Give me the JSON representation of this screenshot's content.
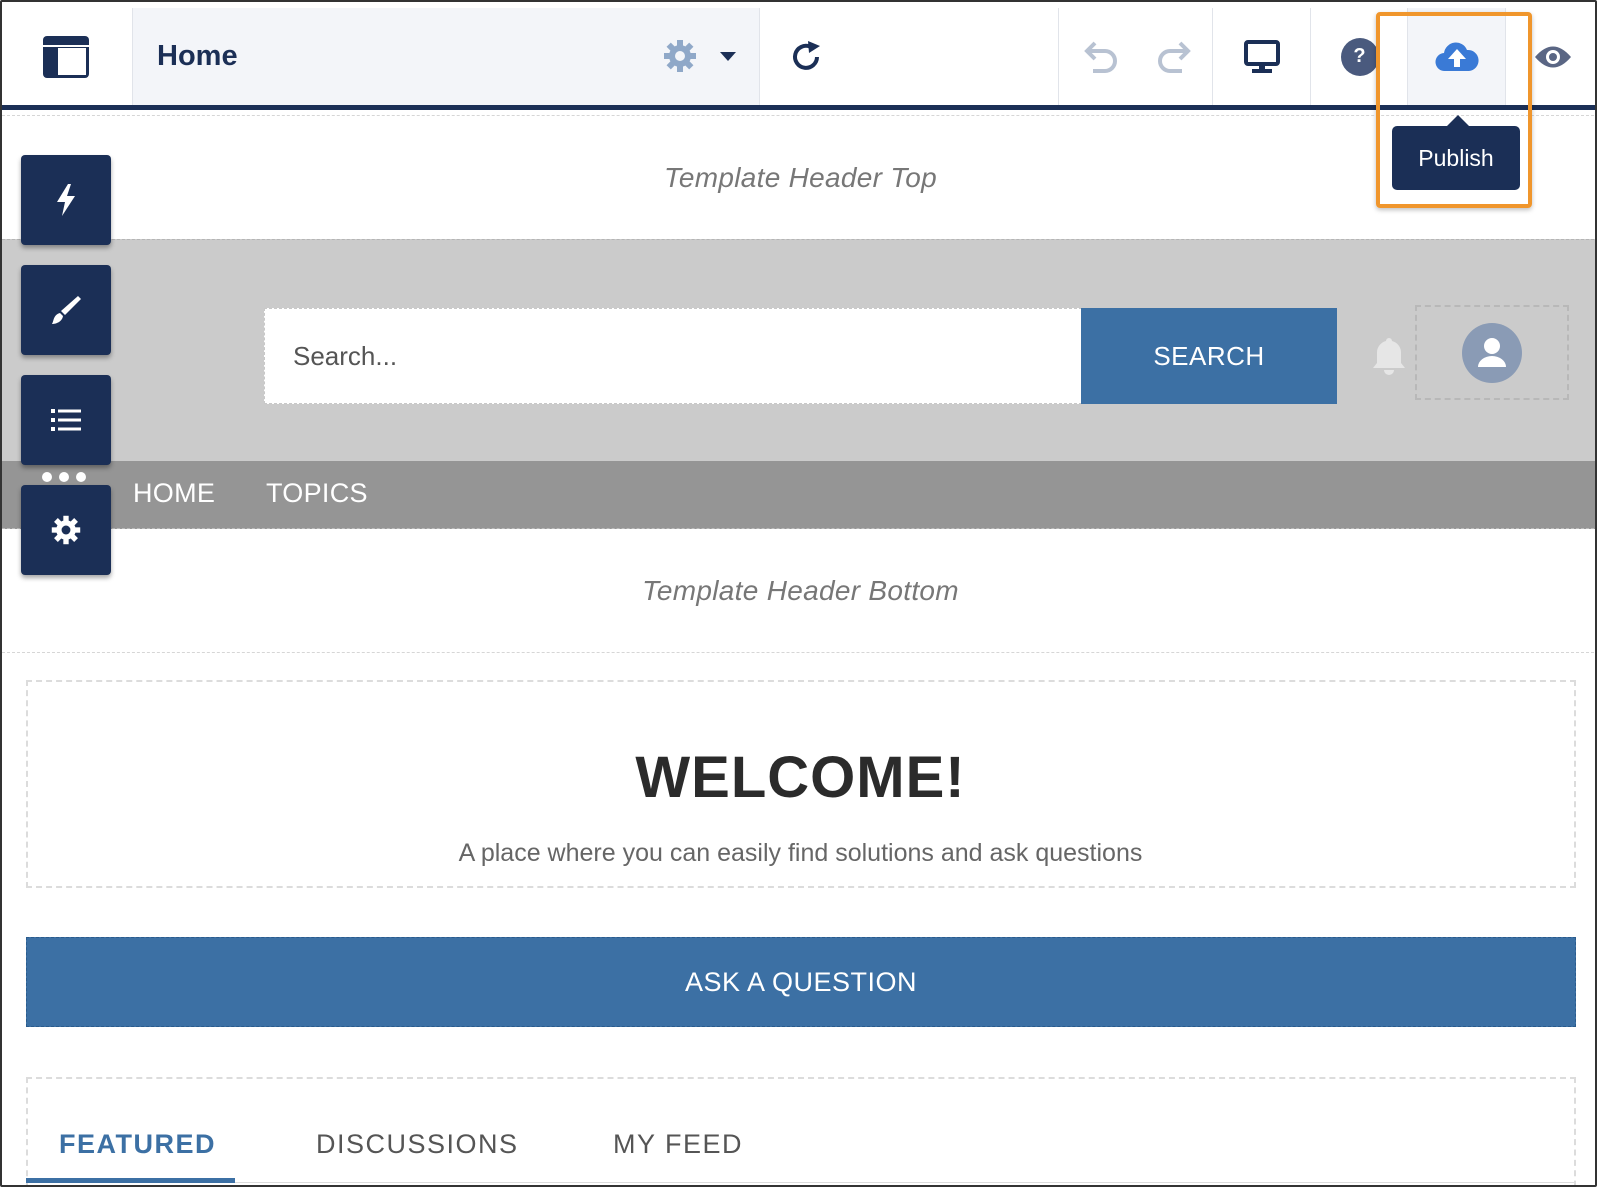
{
  "toolbar": {
    "page_title": "Home",
    "publish_tooltip": "Publish"
  },
  "icons": {
    "layout": "layout-icon",
    "page_settings": "gear-icon",
    "page_menu": "chevron-down-icon",
    "refresh": "refresh-icon",
    "undo": "undo-icon",
    "redo": "redo-icon",
    "device": "desktop-icon",
    "help": "help-icon",
    "publish": "cloud-upload-icon",
    "preview": "eye-icon",
    "components": "lightning-icon",
    "theme": "brush-icon",
    "page_structure": "list-icon",
    "settings": "gear-icon",
    "notifications": "bell-icon",
    "user": "user-avatar-icon"
  },
  "canvas": {
    "header_top_label": "Template Header Top",
    "header_bottom_label": "Template Header Bottom",
    "search": {
      "placeholder": "Search...",
      "button_label": "SEARCH"
    },
    "nav": [
      "HOME",
      "TOPICS"
    ],
    "welcome": {
      "title": "WELCOME!",
      "subtitle": "A place where you can easily find solutions and ask questions"
    },
    "ask_button": "ASK A QUESTION",
    "tabs": [
      {
        "label": "FEATURED",
        "active": true
      },
      {
        "label": "DISCUSSIONS",
        "active": false
      },
      {
        "label": "MY FEED",
        "active": false
      }
    ]
  },
  "colors": {
    "brand_navy": "#1b2f56",
    "accent_blue": "#3c70a4",
    "highlight_orange": "#f0962c",
    "publish_icon_blue": "#3a7ad6"
  }
}
